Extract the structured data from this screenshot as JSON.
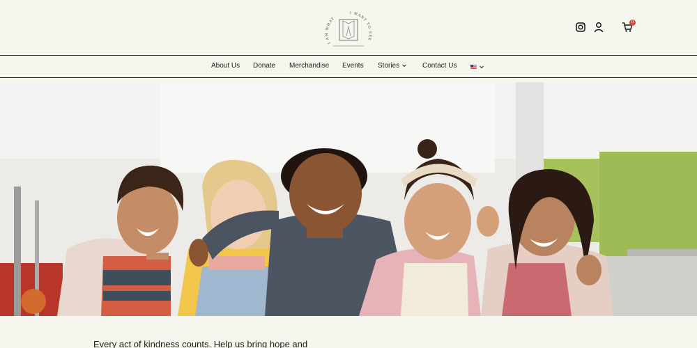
{
  "header": {
    "logo_text_left": "I AM WHAT",
    "logo_text_right": "I WANT TO SEE",
    "cart_count": "0"
  },
  "icons": {
    "instagram": "instagram-icon",
    "user": "user-icon",
    "cart": "cart-icon",
    "flag": "us-flag-icon",
    "chevron": "chevron-down-icon"
  },
  "nav": {
    "items": [
      {
        "label": "About Us"
      },
      {
        "label": "Donate"
      },
      {
        "label": "Merchandise"
      },
      {
        "label": "Events"
      },
      {
        "label": "Stories"
      },
      {
        "label": "Contact Us"
      }
    ]
  },
  "main": {
    "tagline": "Every act of kindness counts. Help us bring hope and"
  },
  "colors": {
    "background": "#f6f5ee",
    "badge": "#d44a3c",
    "text": "#1d1d1d"
  }
}
